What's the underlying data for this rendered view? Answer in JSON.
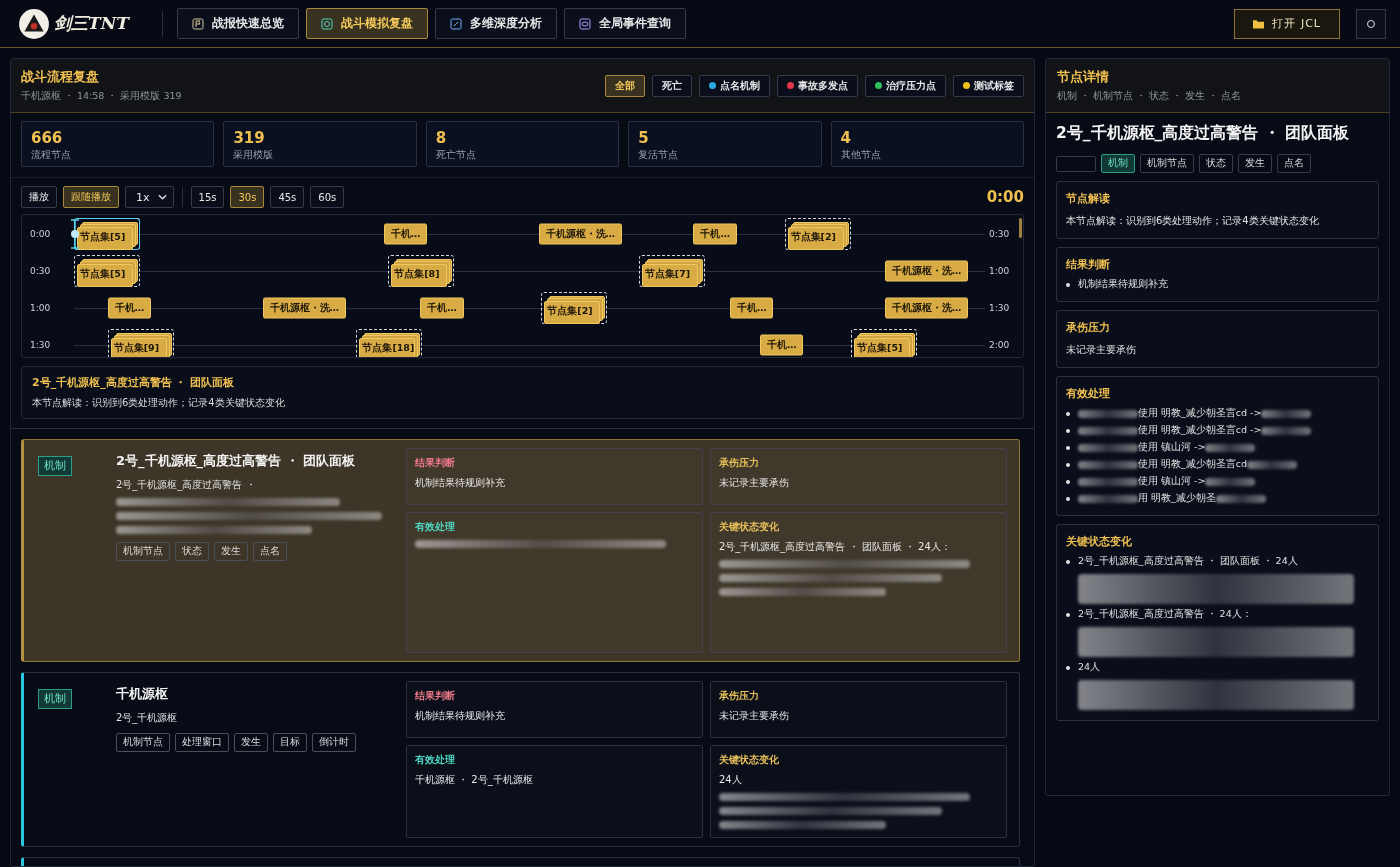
{
  "header": {
    "logo_text": "剑三TNT",
    "nav": [
      {
        "label": "战报快速总览",
        "selected": false
      },
      {
        "label": "战斗模拟复盘",
        "selected": true
      },
      {
        "label": "多维深度分析",
        "selected": false
      },
      {
        "label": "全局事件查询",
        "selected": false
      }
    ],
    "open_button": "打开 JCL"
  },
  "replay": {
    "title": "战斗流程复盘",
    "subtitle": "千机源枢 ・ 14:58 ・ 采用模版 319",
    "filters": [
      {
        "label": "全部",
        "selected": true
      },
      {
        "label": "死亡",
        "selected": false
      },
      {
        "label": "点名机制",
        "selected": false,
        "color": "#2aa8e0"
      },
      {
        "label": "事故多发点",
        "selected": false,
        "color": "#e0354a"
      },
      {
        "label": "治疗压力点",
        "selected": false,
        "color": "#2fbf5a"
      },
      {
        "label": "测试标签",
        "selected": false,
        "color": "#f0c020"
      }
    ],
    "stats": [
      {
        "value": "666",
        "label": "流程节点"
      },
      {
        "value": "319",
        "label": "采用模版"
      },
      {
        "value": "8",
        "label": "死亡节点"
      },
      {
        "value": "5",
        "label": "复活节点"
      },
      {
        "value": "4",
        "label": "其他节点"
      }
    ],
    "controls": {
      "play": "播放",
      "follow": {
        "label": "跟随播放",
        "on": true
      },
      "speed": "1x",
      "windows": [
        {
          "label": "15s",
          "selected": false
        },
        {
          "label": "30s",
          "selected": true
        },
        {
          "label": "45s",
          "selected": false
        },
        {
          "label": "60s",
          "selected": false
        }
      ],
      "time": "0:00"
    },
    "timeline": {
      "rows": [
        {
          "label": "0:00",
          "end_label": "0:30",
          "nodes": [
            {
              "kind": "cluster",
              "label": "节点集[5]",
              "current": true
            },
            {
              "kind": "single",
              "label": "千机…",
              "current": false
            },
            {
              "kind": "single",
              "label": "千机源枢・洗…",
              "current": false
            },
            {
              "kind": "single",
              "label": "千机…",
              "current": false
            },
            {
              "kind": "cluster",
              "label": "节点集[2]",
              "current": false
            }
          ]
        },
        {
          "label": "0:30",
          "end_label": "1:00",
          "nodes": [
            {
              "kind": "cluster",
              "label": "节点集[5]",
              "current": false
            },
            {
              "kind": "cluster",
              "label": "节点集[8]",
              "current": false
            },
            {
              "kind": "cluster",
              "label": "节点集[7]",
              "current": false
            },
            {
              "kind": "single",
              "label": "千机源枢・洗…",
              "current": false
            }
          ]
        },
        {
          "label": "1:00",
          "end_label": "1:30",
          "nodes": [
            {
              "kind": "single",
              "label": "千机…",
              "current": false
            },
            {
              "kind": "single",
              "label": "千机源枢・洗…",
              "current": false
            },
            {
              "kind": "single",
              "label": "千机…",
              "current": false
            },
            {
              "kind": "cluster",
              "label": "节点集[2]",
              "current": false
            },
            {
              "kind": "single",
              "label": "千机…",
              "current": false
            },
            {
              "kind": "single",
              "label": "千机源枢・洗…",
              "current": false
            }
          ]
        },
        {
          "label": "1:30",
          "end_label": "2:00",
          "nodes": [
            {
              "kind": "cluster",
              "label": "节点集[9]",
              "current": false
            },
            {
              "kind": "cluster",
              "label": "节点集[18]",
              "current": false
            },
            {
              "kind": "single",
              "label": "千机…",
              "current": false
            },
            {
              "kind": "cluster",
              "label": "节点集[5]",
              "current": false
            }
          ]
        }
      ]
    },
    "summary": {
      "title": "2号_千机源枢_高度过高警告 ・ 团队面板",
      "text": "本节点解读：识别到6类处理动作；记录4类关键状态变化"
    },
    "cards": [
      {
        "selected": true,
        "tag": "机制",
        "title": "2号_千机源枢_高度过高警告 ・ 团队面板",
        "desc": {
          "text": "2号_千机源枢_高度过高警告 ・",
          "redacted": true
        },
        "tags": [
          "机制节点",
          "状态",
          "发生",
          "点名"
        ],
        "cells": [
          {
            "kind": "result",
            "label": "结果判断",
            "text": "机制结果待规则补充",
            "redacted": false
          },
          {
            "kind": "pressure",
            "label": "承伤压力",
            "text": "未记录主要承伤",
            "redacted": false
          },
          {
            "kind": "handling",
            "label": "有效处理",
            "text": "",
            "redacted": true
          },
          {
            "kind": "state",
            "label": "关键状态变化",
            "text": "2号_千机源枢_高度过高警告 ・ 团队面板 ・ 24人：",
            "redacted": true
          }
        ]
      },
      {
        "selected": false,
        "tag": "机制",
        "title": "千机源枢",
        "desc": {
          "text": "2号_千机源枢",
          "redacted": false
        },
        "tags": [
          "机制节点",
          "处理窗口",
          "发生",
          "目标",
          "倒计时"
        ],
        "cells": [
          {
            "kind": "result",
            "label": "结果判断",
            "text": "机制结果待规则补充",
            "redacted": false
          },
          {
            "kind": "pressure",
            "label": "承伤压力",
            "text": "未记录主要承伤",
            "redacted": false
          },
          {
            "kind": "handling",
            "label": "有效处理",
            "text": "千机源枢 ・ 2号_千机源枢",
            "redacted": false
          },
          {
            "kind": "state",
            "label": "关键状态变化",
            "text": "24人",
            "redacted": true
          }
        ]
      }
    ]
  },
  "detail": {
    "title": "节点详情",
    "subtitle": "机制 ・ 机制节点 ・ 状态 ・ 发生 ・ 点名",
    "node_title": "2号_千机源枢_高度过高警告 ・ 团队面板",
    "tags": [
      {
        "label": "机制",
        "kind": "type"
      },
      {
        "label": "机制节点",
        "kind": "plain"
      },
      {
        "label": "状态",
        "kind": "plain"
      },
      {
        "label": "发生",
        "kind": "plain"
      },
      {
        "label": "点名",
        "kind": "plain"
      }
    ],
    "sections": [
      {
        "title": "节点解读",
        "kind": "text",
        "text": "本节点解读：识别到6类处理动作；记录4类关键状态变化"
      },
      {
        "title": "结果判断",
        "kind": "list",
        "items": [
          {
            "text": "机制结果待规则补充",
            "blur_before": false,
            "blur_after": false
          }
        ]
      },
      {
        "title": "承伤压力",
        "kind": "text",
        "text": "未记录主要承伤"
      },
      {
        "title": "有效处理",
        "kind": "list",
        "items": [
          {
            "text": "使用 明教_减少朝圣言cd ->",
            "blur_before": true,
            "blur_after": true
          },
          {
            "text": "使用 明教_减少朝圣言cd ->",
            "blur_before": true,
            "blur_after": true
          },
          {
            "text": "使用 镇山河 ->",
            "blur_before": true,
            "blur_after": true
          },
          {
            "text": "使用 明教_减少朝圣言cd",
            "blur_before": true,
            "blur_after": true
          },
          {
            "text": "使用 镇山河 ->",
            "blur_before": true,
            "blur_after": true
          },
          {
            "text": "用 明教_减少朝圣",
            "blur_before": true,
            "blur_after": true
          }
        ]
      },
      {
        "title": "关键状态变化",
        "kind": "list",
        "items": [
          {
            "text": "2号_千机源枢_高度过高警告 ・ 团队面板 ・ 24人",
            "blur_before": false,
            "blur_after": true
          },
          {
            "text": "2号_千机源枢_高度过高警告 ・ 24人：",
            "blur_before": false,
            "blur_after": true
          },
          {
            "text": "24人",
            "blur_before": false,
            "blur_after": true
          }
        ]
      }
    ]
  }
}
